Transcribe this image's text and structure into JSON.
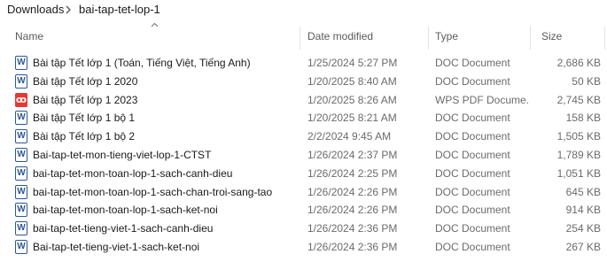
{
  "breadcrumb": {
    "items": [
      "Downloads",
      "bai-tap-tet-lop-1"
    ]
  },
  "columns": {
    "name": "Name",
    "date": "Date modified",
    "type": "Type",
    "size": "Size"
  },
  "icons": {
    "word": "W",
    "pdf": "ꝏ"
  },
  "files": [
    {
      "icon": "word",
      "name": "Bài tập Tết lớp 1 (Toán, Tiếng Việt, Tiếng Anh)",
      "date": "1/25/2024 5:27 PM",
      "type": "DOC Document",
      "size": "2,686 KB"
    },
    {
      "icon": "word",
      "name": "Bài tập Tết lớp 1 2020",
      "date": "1/20/2025 8:40 AM",
      "type": "DOC Document",
      "size": "50 KB"
    },
    {
      "icon": "pdf",
      "name": "Bài tập Tết lớp 1 2023",
      "date": "1/20/2025 8:26 AM",
      "type": "WPS PDF Docume...",
      "size": "2,745 KB"
    },
    {
      "icon": "word",
      "name": "Bài tập Tết lớp 1 bộ 1",
      "date": "1/20/2025 8:21 AM",
      "type": "DOC Document",
      "size": "158 KB"
    },
    {
      "icon": "word",
      "name": "Bài tập Tết lớp 1 bộ 2",
      "date": "2/2/2024 9:45 AM",
      "type": "DOC Document",
      "size": "1,505 KB"
    },
    {
      "icon": "word",
      "name": "Bai-tap-tet-mon-tieng-viet-lop-1-CTST",
      "date": "1/26/2024 2:37 PM",
      "type": "DOC Document",
      "size": "1,789 KB"
    },
    {
      "icon": "word",
      "name": "bai-tap-tet-mon-toan-lop-1-sach-canh-dieu",
      "date": "1/26/2024 2:25 PM",
      "type": "DOC Document",
      "size": "1,051 KB"
    },
    {
      "icon": "word",
      "name": "bai-tap-tet-mon-toan-lop-1-sach-chan-troi-sang-tao",
      "date": "1/26/2024 2:26 PM",
      "type": "DOC Document",
      "size": "645 KB"
    },
    {
      "icon": "word",
      "name": "bai-tap-tet-mon-toan-lop-1-sach-ket-noi",
      "date": "1/26/2024 2:26 PM",
      "type": "DOC Document",
      "size": "914 KB"
    },
    {
      "icon": "word",
      "name": "bai-tap-tet-tieng-viet-1-sach-canh-dieu",
      "date": "1/26/2024 2:36 PM",
      "type": "DOC Document",
      "size": "254 KB"
    },
    {
      "icon": "word",
      "name": "Bai-tap-tet-tieng-viet-1-sach-ket-noi",
      "date": "1/26/2024 2:36 PM",
      "type": "DOC Document",
      "size": "267 KB"
    }
  ]
}
